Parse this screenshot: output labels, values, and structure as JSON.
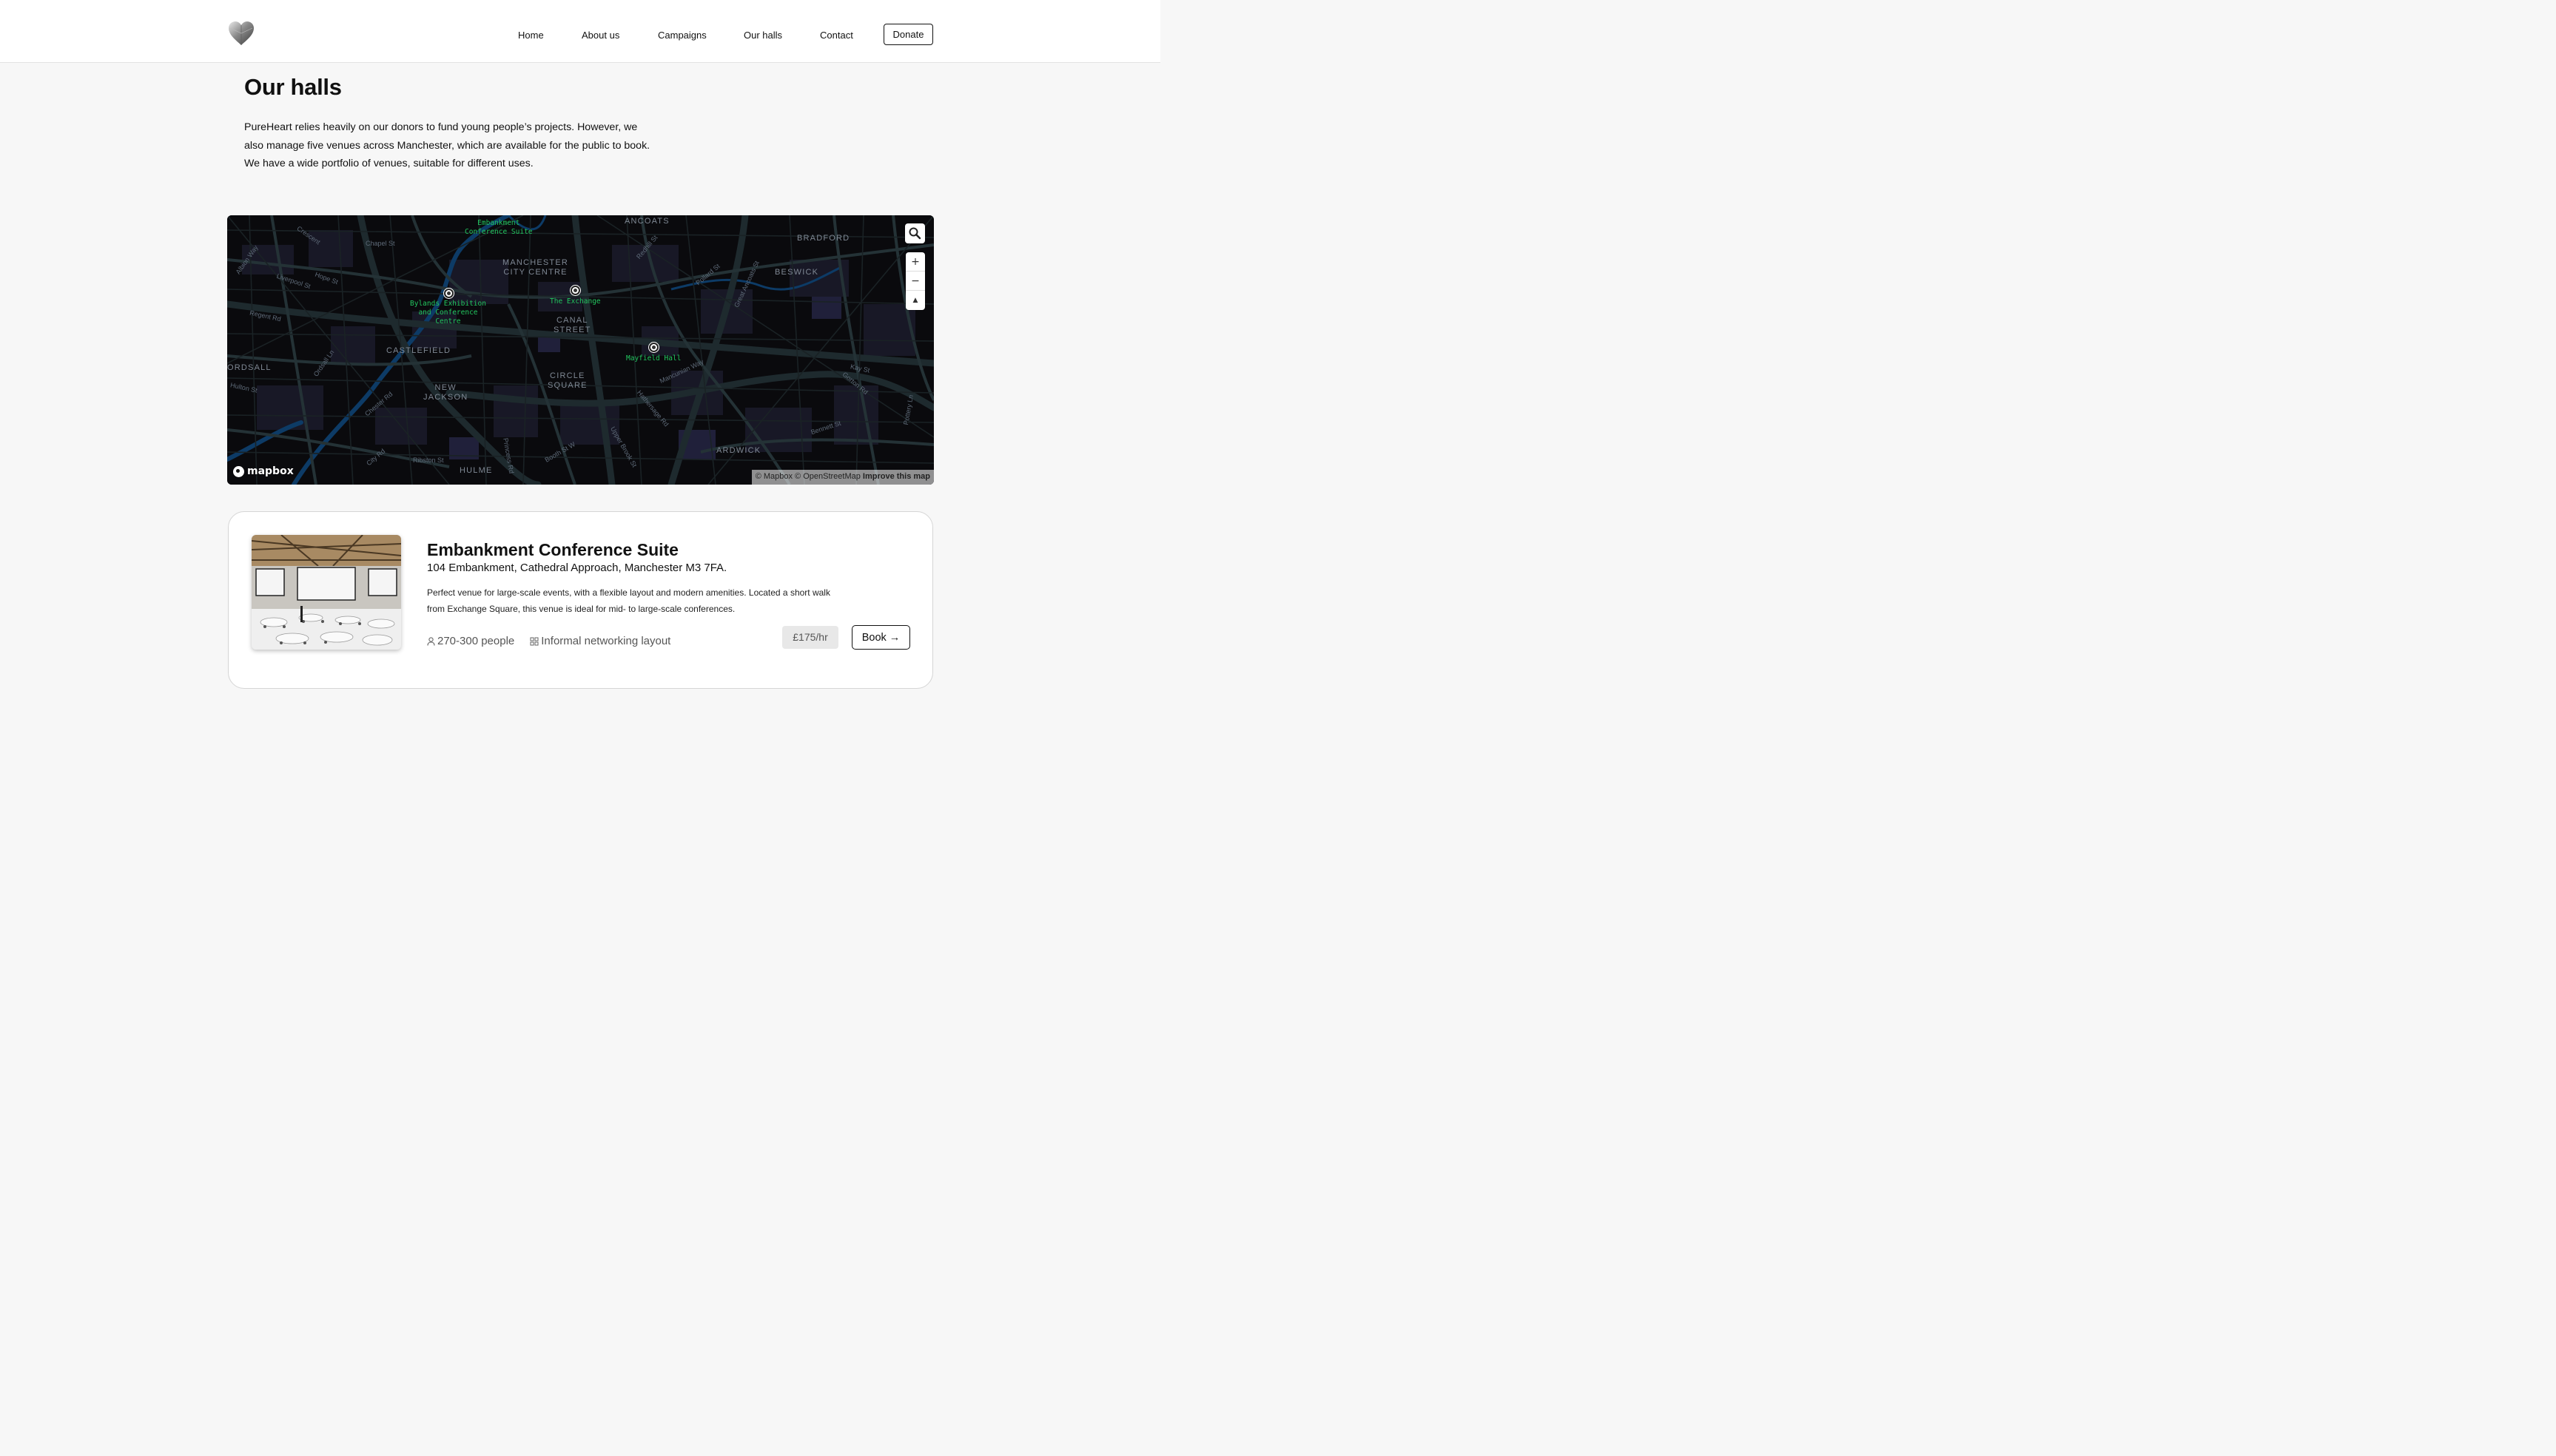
{
  "header": {
    "nav": [
      "Home",
      "About us",
      "Campaigns",
      "Our halls",
      "Contact"
    ],
    "donate_label": "Donate",
    "logo_icon": "heart-logo-icon"
  },
  "main": {
    "title": "Our halls",
    "intro": "PureHeart relies heavily on our donors to fund young people’s projects. However, we also manage five venues across Manchester, which are available for the public to book. We have a wide portfolio of venues, suitable for different uses."
  },
  "map": {
    "district_labels": [
      "ANCOATS",
      "BRADFORD",
      "MANCHESTER\nCITY CENTRE",
      "BESWICK",
      "CANAL\nSTREET",
      "CASTLEFIELD",
      "ORDSALL",
      "CIRCLE\nSQUARE",
      "NEW\nJACKSON",
      "ARDWICK",
      "HULME"
    ],
    "street_labels": [
      "Chapel St",
      "Crescent",
      "Liverpool St",
      "Hope St",
      "Regent Rd",
      "Ordsall Ln",
      "Hulton St",
      "Chester Rd",
      "City Rd",
      "Ribston St",
      "Princess Rd",
      "Booth St W",
      "Upper Brook St",
      "Hathersage Rd",
      "Mancunian Way",
      "Pollard St",
      "Kay St",
      "Gorton Rd",
      "Bennett St",
      "Pottery Ln",
      "Redhill St",
      "Great Ancoats St",
      "Albion Way"
    ],
    "venues": [
      {
        "name": "Embankment\nConference Suite"
      },
      {
        "name": "Bylands Exhibition\nand Conference\nCentre"
      },
      {
        "name": "The Exchange"
      },
      {
        "name": "Mayfield Hall"
      }
    ],
    "controls": {
      "search_icon": "search-icon",
      "zoom_in": "+",
      "zoom_out": "−",
      "compass": "▲"
    },
    "brand": "mapbox",
    "attribution": "© Mapbox © OpenStreetMap",
    "improve_link": "Improve this map"
  },
  "venue_card": {
    "title": "Embankment Conference Suite",
    "address": "104 Embankment, Cathedral Approach, Manchester M3 7FA.",
    "description": "Perfect venue for large-scale events, with a flexible layout and modern amenities. Located a short walk from Exchange Square, this venue is ideal for mid- to large-scale conferences.",
    "capacity": "270-300 people",
    "layout": "Informal networking layout",
    "price": "£175/hr",
    "book_label": "Book →"
  }
}
